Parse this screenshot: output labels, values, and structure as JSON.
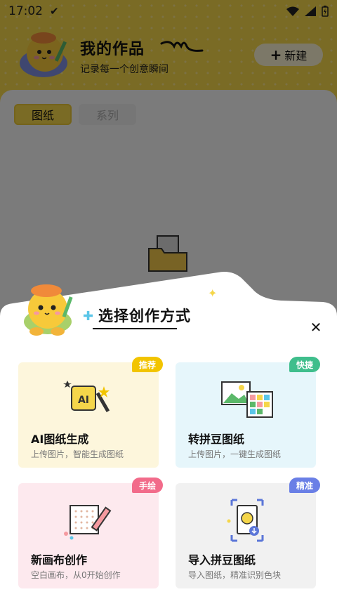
{
  "status_bar": {
    "time": "17:02",
    "check_icon": "check-icon",
    "wifi_icon": "wifi-icon",
    "signal_icon": "signal-icon",
    "battery_icon": "battery-icon"
  },
  "header": {
    "title": "我的作品",
    "subtitle": "记录每一个创意瞬间",
    "new_button_label": "新建"
  },
  "tabs": [
    {
      "label": "图纸",
      "active": true
    },
    {
      "label": "系列",
      "active": false
    }
  ],
  "sheet": {
    "title": "选择创作方式",
    "close_icon": "close-icon",
    "options": [
      {
        "title": "AI图纸生成",
        "desc": "上传图片，智能生成图纸",
        "badge": "推荐",
        "badge_color": "#f2c400"
      },
      {
        "title": "转拼豆图纸",
        "desc": "上传图片，一键生成图纸",
        "badge": "快捷",
        "badge_color": "#3fbe8c"
      },
      {
        "title": "新画布创作",
        "desc": "空白画布，从0开始创作",
        "badge": "手绘",
        "badge_color": "#f26b8a"
      },
      {
        "title": "导入拼豆图纸",
        "desc": "导入图纸，精准识别色块",
        "badge": "精准",
        "badge_color": "#6a7fe6"
      }
    ]
  },
  "colors": {
    "brand_yellow": "#f5d64a",
    "overlay": "#000000"
  }
}
